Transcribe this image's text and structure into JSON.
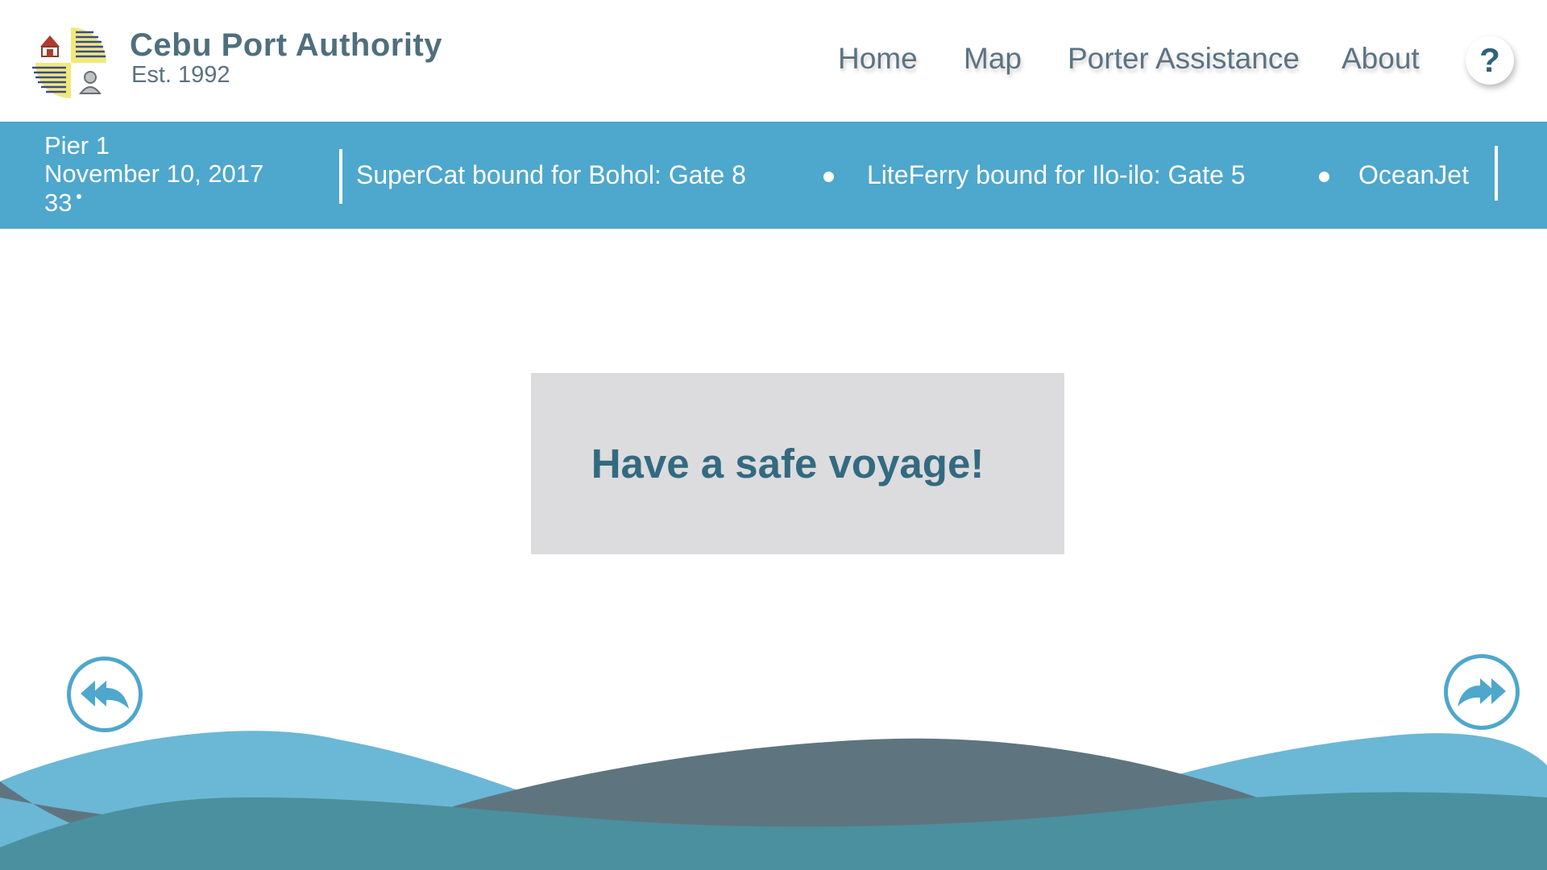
{
  "header": {
    "title": "Cebu Port Authority",
    "subtitle": "Est. 1992",
    "nav": {
      "home": "Home",
      "map": "Map",
      "porter": "Porter Assistance",
      "about": "About"
    },
    "help_label": "?"
  },
  "info_bar": {
    "pier": "Pier 1",
    "date": "November 10, 2017",
    "temperature": "33",
    "ticker": [
      "SuperCat bound for Bohol: Gate 8",
      "LiteFerry bound for Ilo-ilo: Gate 5",
      "OceanJet"
    ]
  },
  "main": {
    "message": "Have a safe voyage!"
  },
  "colors": {
    "accent": "#4ea7cd",
    "brand_text": "#4f6f7d",
    "message_text": "#336a80",
    "message_bg": "#dcdcde",
    "wave_light": "#6bb7d6",
    "wave_slate": "#5e7580",
    "wave_teal": "#4a909f"
  },
  "icons": {
    "logo": "port-authority-logo",
    "help": "question-mark-icon",
    "back": "reply-back-arrow-icon",
    "forward": "forward-arrow-icon"
  }
}
